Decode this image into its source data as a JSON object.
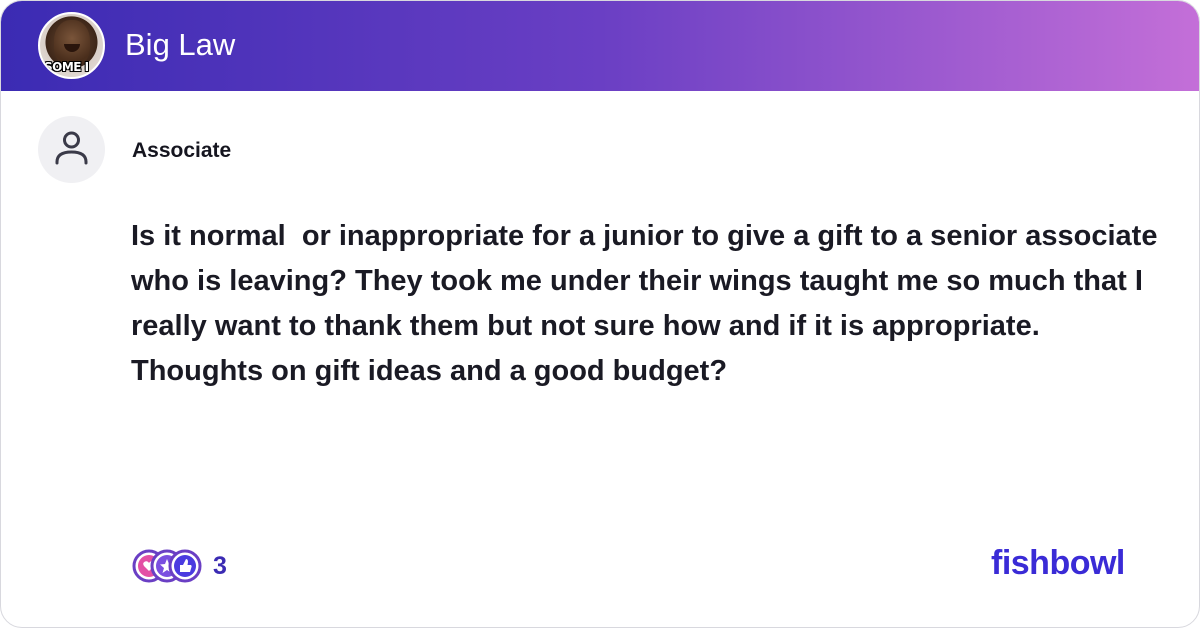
{
  "header": {
    "group_name": "Big Law",
    "group_avatar_caption": "SOME I",
    "group_avatar_icon": "group-meme-avatar"
  },
  "post": {
    "author_role": "Associate",
    "author_avatar_icon": "user-placeholder-icon",
    "body": "Is it normal  or inappropriate for a junior to give a gift to a senior associate who is leaving? They took me under their wings taught me so much that I really want to thank them but not sure how and if it is appropriate. Thoughts on gift ideas and a good budget?"
  },
  "footer": {
    "reaction_icons": [
      "heart-reaction-icon",
      "star-reaction-icon",
      "like-reaction-icon"
    ],
    "reaction_count": "3",
    "brand": "fishbowl"
  },
  "colors": {
    "header_gradient_start": "#3b2bb3",
    "header_gradient_end": "#c46fd8",
    "brand": "#3a2bd6",
    "text": "#1a1a24"
  }
}
